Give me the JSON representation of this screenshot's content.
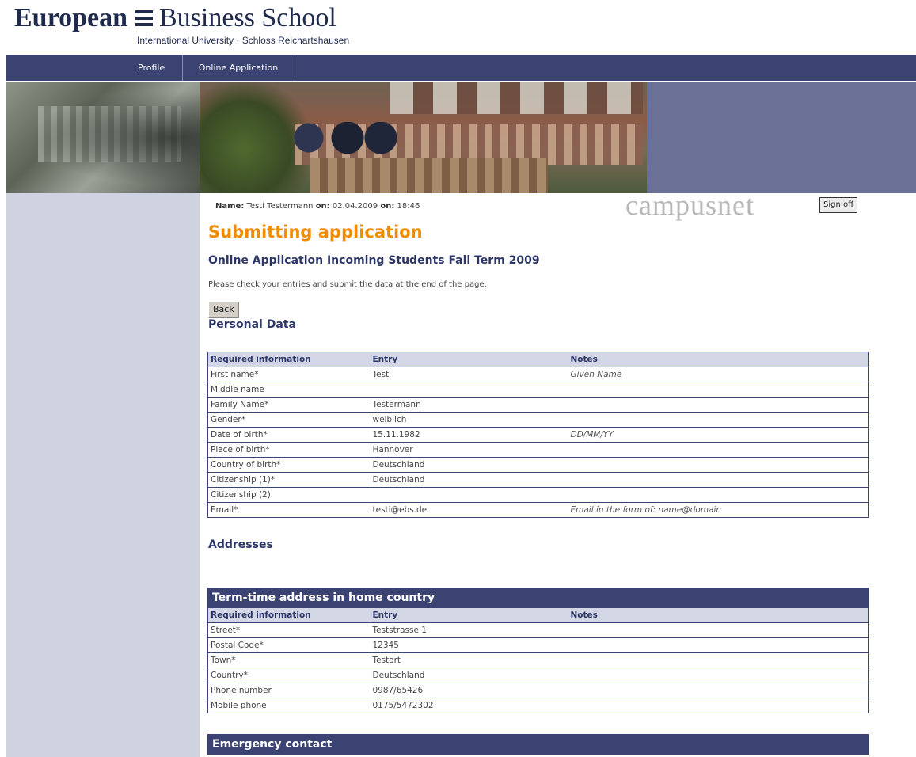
{
  "logo": {
    "word1": "European",
    "word2": "Business School",
    "tagline": "International University · Schloss Reichartshausen"
  },
  "nav": {
    "items": [
      {
        "label": "Profile"
      },
      {
        "label": "Online Application"
      }
    ]
  },
  "header": {
    "name_label": "Name:",
    "name_value": "Testi Testermann",
    "on_label1": "on:",
    "date": "02.04.2009",
    "on_label2": "on:",
    "time": "18:46",
    "campusnet": "campusnet",
    "signoff_label": "Sign off"
  },
  "page": {
    "title": "Submitting application",
    "subtitle": "Online Application Incoming Students Fall Term 2009",
    "instruction": "Please check your entries and submit the data at the end of the page.",
    "back_label": "Back"
  },
  "personal": {
    "heading": "Personal Data",
    "columns": [
      "Required information",
      "Entry",
      "Notes"
    ],
    "rows": [
      {
        "label": "First name*",
        "entry": "Testi",
        "note": "Given Name"
      },
      {
        "label": "Middle name",
        "entry": "",
        "note": ""
      },
      {
        "label": "Family Name*",
        "entry": "Testermann",
        "note": ""
      },
      {
        "label": "Gender*",
        "entry": "weiblich",
        "note": ""
      },
      {
        "label": "Date of birth*",
        "entry": "15.11.1982",
        "note": "DD/MM/YY"
      },
      {
        "label": "Place of birth*",
        "entry": "Hannover",
        "note": ""
      },
      {
        "label": "Country of birth*",
        "entry": "Deutschland",
        "note": ""
      },
      {
        "label": "Citizenship (1)*",
        "entry": "Deutschland",
        "note": ""
      },
      {
        "label": "Citizenship (2)",
        "entry": "",
        "note": ""
      },
      {
        "label": "Email*",
        "entry": "testi@ebs.de",
        "note": "Email in the form of: name@domain"
      }
    ]
  },
  "addresses": {
    "heading": "Addresses",
    "term_time": {
      "caption": "Term-time address in home country",
      "columns": [
        "Required information",
        "Entry",
        "Notes"
      ],
      "rows": [
        {
          "label": "Street*",
          "entry": "Teststrasse 1",
          "note": ""
        },
        {
          "label": "Postal Code*",
          "entry": "12345",
          "note": ""
        },
        {
          "label": "Town*",
          "entry": "Testort",
          "note": ""
        },
        {
          "label": "Country*",
          "entry": "Deutschland",
          "note": ""
        },
        {
          "label": "Phone number",
          "entry": "0987/65426",
          "note": ""
        },
        {
          "label": "Mobile phone",
          "entry": "0175/5472302",
          "note": ""
        }
      ]
    },
    "emergency": {
      "caption": "Emergency contact"
    }
  },
  "colors": {
    "nav_bg": "#3b4373",
    "title_orange": "#f08c00",
    "heading_blue": "#2d3668",
    "sidebar": "#cfd3e0"
  }
}
